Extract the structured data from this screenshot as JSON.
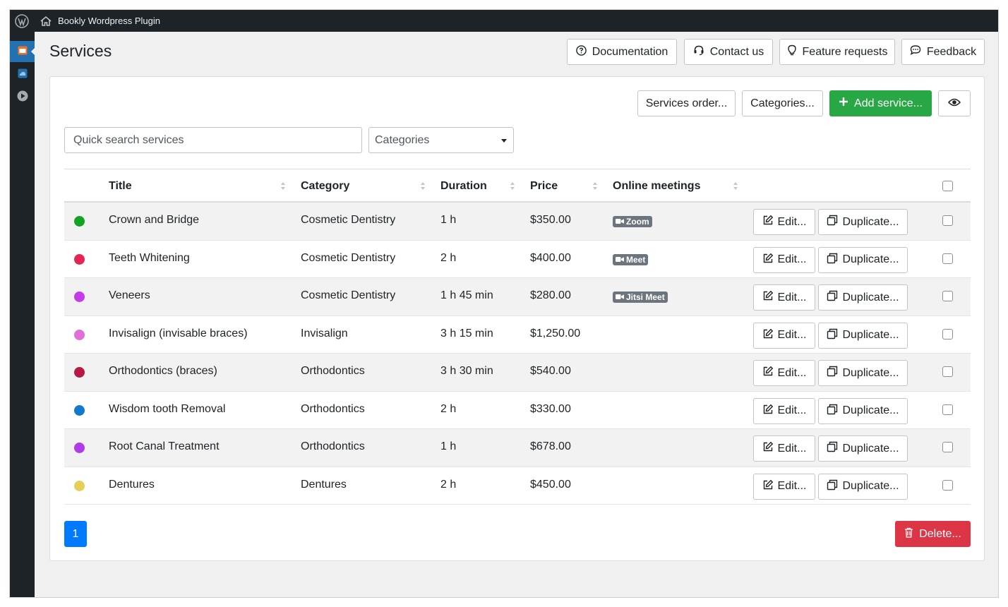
{
  "app": {
    "site_name": "Bookly Wordpress Plugin"
  },
  "page": {
    "title": "Services"
  },
  "top_buttons": {
    "documentation": "Documentation",
    "contact": "Contact us",
    "feature": "Feature requests",
    "feedback": "Feedback"
  },
  "toolbar": {
    "services_order": "Services order...",
    "categories": "Categories...",
    "add_service": "Add service..."
  },
  "filters": {
    "search_placeholder": "Quick search services",
    "category_select": "Categories"
  },
  "table": {
    "headers": {
      "title": "Title",
      "category": "Category",
      "duration": "Duration",
      "price": "Price",
      "online": "Online meetings"
    },
    "edit_label": "Edit...",
    "duplicate_label": "Duplicate...",
    "rows": [
      {
        "color": "#12a322",
        "title": "Crown and Bridge",
        "category": "Cosmetic Dentistry",
        "duration": "1 h",
        "price": "$350.00",
        "online": "Zoom"
      },
      {
        "color": "#e5254f",
        "title": "Teeth Whitening",
        "category": "Cosmetic Dentistry",
        "duration": "2 h",
        "price": "$400.00",
        "online": "Meet"
      },
      {
        "color": "#c43be9",
        "title": "Veneers",
        "category": "Cosmetic Dentistry",
        "duration": "1 h 45 min",
        "price": "$280.00",
        "online": "Jitsi Meet"
      },
      {
        "color": "#e06fd8",
        "title": "Invisalign (invisable braces)",
        "category": "Invisalign",
        "duration": "3 h 15 min",
        "price": "$1,250.00",
        "online": ""
      },
      {
        "color": "#b81846",
        "title": "Orthodontics (braces)",
        "category": "Orthodontics",
        "duration": "3 h 30 min",
        "price": "$540.00",
        "online": ""
      },
      {
        "color": "#1379d0",
        "title": "Wisdom tooth Removal",
        "category": "Orthodontics",
        "duration": "2 h",
        "price": "$330.00",
        "online": ""
      },
      {
        "color": "#b13be9",
        "title": "Root Canal Treatment",
        "category": "Orthodontics",
        "duration": "1 h",
        "price": "$678.00",
        "online": ""
      },
      {
        "color": "#e6cf57",
        "title": "Dentures",
        "category": "Dentures",
        "duration": "2 h",
        "price": "$450.00",
        "online": ""
      }
    ]
  },
  "pagination": {
    "current": "1"
  },
  "delete_label": "Delete..."
}
